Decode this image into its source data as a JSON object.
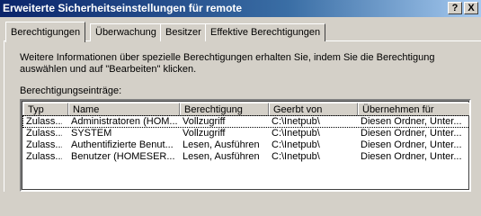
{
  "window": {
    "title": "Erweiterte Sicherheitseinstellungen für remote",
    "help_label": "?",
    "close_label": "X"
  },
  "tabs": [
    {
      "label": "Berechtigungen",
      "active": true
    },
    {
      "label": "Überwachung",
      "active": false
    },
    {
      "label": "Besitzer",
      "active": false
    },
    {
      "label": "Effektive Berechtigungen",
      "active": false
    }
  ],
  "info_text": "Weitere Informationen über spezielle Berechtigungen erhalten Sie, indem Sie die Berechtigung auswählen und auf \"Bearbeiten\" klicken.",
  "list": {
    "label": "Berechtigungseinträge:",
    "columns": [
      "Typ",
      "Name",
      "Berechtigung",
      "Geerbt von",
      "Übernehmen für"
    ],
    "rows": [
      [
        "Zulass...",
        "Administratoren (HOM...",
        "Vollzugriff",
        "C:\\Inetpub\\",
        "Diesen Ordner, Unter..."
      ],
      [
        "Zulass...",
        "SYSTEM",
        "Vollzugriff",
        "C:\\Inetpub\\",
        "Diesen Ordner, Unter..."
      ],
      [
        "Zulass...",
        "Authentifizierte Benut...",
        "Lesen, Ausführen",
        "C:\\Inetpub\\",
        "Diesen Ordner, Unter..."
      ],
      [
        "Zulass...",
        "Benutzer (HOMESER...",
        "Lesen, Ausführen",
        "C:\\Inetpub\\",
        "Diesen Ordner, Unter..."
      ]
    ]
  }
}
